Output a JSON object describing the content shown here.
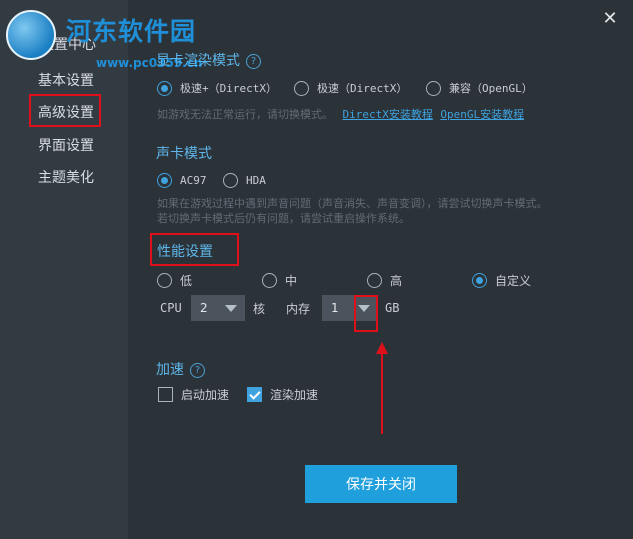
{
  "watermark": {
    "title": "河东软件园",
    "url": "www.pc0359.cn"
  },
  "sidebar": {
    "header": "设置中心",
    "items": [
      {
        "label": "基本设置"
      },
      {
        "label": "高级设置"
      },
      {
        "label": "界面设置"
      },
      {
        "label": "主题美化"
      }
    ]
  },
  "render": {
    "title": "显卡渲染模式",
    "options": [
      "极速+（DirectX）",
      "极速（DirectX）",
      "兼容（OpenGL）"
    ],
    "selected": 0,
    "hint": "如游戏无法正常运行，请切换模式。",
    "link_directx": "DirectX安装教程",
    "link_opengl": "OpenGL安装教程"
  },
  "sound": {
    "title": "声卡模式",
    "options": [
      "AC97",
      "HDA"
    ],
    "selected": 0,
    "hint_line1": "如果在游戏过程中遇到声音问题（声音消失、声音变调），请尝试切换声卡模式。",
    "hint_line2": "若切换声卡模式后仍有问题，请尝试重启操作系统。"
  },
  "performance": {
    "title": "性能设置",
    "options": [
      "低",
      "中",
      "高",
      "自定义"
    ],
    "selected": 3,
    "cpu_label": "CPU",
    "cpu_value": "2",
    "cpu_unit": "核",
    "mem_label": "内存",
    "mem_value": "1",
    "mem_unit": "GB"
  },
  "accel": {
    "title": "加速",
    "boot": {
      "label": "启动加速",
      "checked": false
    },
    "render": {
      "label": "渲染加速",
      "checked": true
    }
  },
  "save_button": "保存并关闭",
  "close_glyph": "✕",
  "help_glyph": "?",
  "colors": {
    "accent": "#3fa3df",
    "annotation": "#e0101a",
    "button": "#1f9fdc"
  }
}
